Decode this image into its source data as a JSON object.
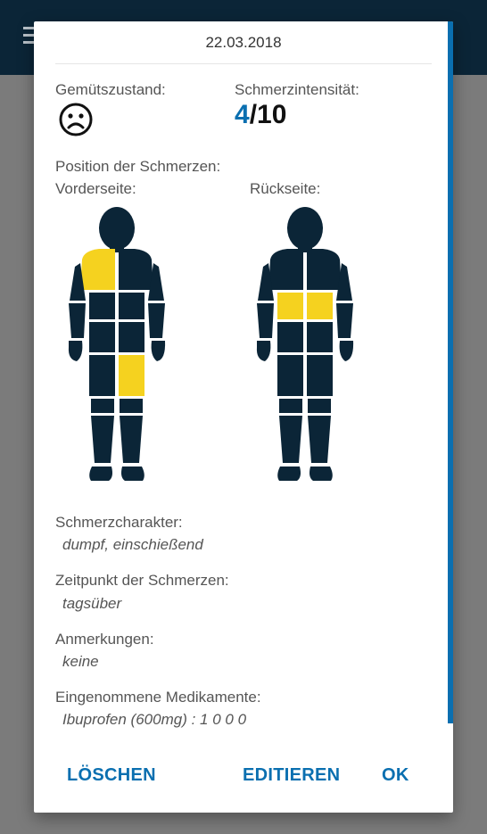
{
  "dialog": {
    "date": "22.03.2018",
    "mood_label": "Gemütszustand:",
    "mood_icon": "sad-face-icon",
    "intensity_label": "Schmerzintensität:",
    "intensity_value": "4",
    "intensity_max": "/10",
    "position_label": "Position der Schmerzen:",
    "front_label": "Vorderseite:",
    "back_label": "Rückseite:",
    "fields": [
      {
        "label": "Schmerzcharakter:",
        "value": "dumpf, einschießend"
      },
      {
        "label": "Zeitpunkt der Schmerzen:",
        "value": "tagsüber"
      },
      {
        "label": "Anmerkungen:",
        "value": "keine"
      },
      {
        "label": "Eingenommene Medikamente:",
        "value": "Ibuprofen (600mg) : 1 0 0 0"
      }
    ],
    "actions": {
      "delete": "LÖSCHEN",
      "edit": "EDITIEREN",
      "ok": "OK"
    }
  },
  "colors": {
    "accent": "#0a6fb0",
    "body": "#0b2537",
    "highlight": "#f5d21f",
    "appbar": "#0b2537"
  },
  "highlighted_regions": {
    "front": [
      "right-shoulder-chest",
      "left-thigh"
    ],
    "back": [
      "lower-back-left",
      "lower-back-right"
    ]
  }
}
